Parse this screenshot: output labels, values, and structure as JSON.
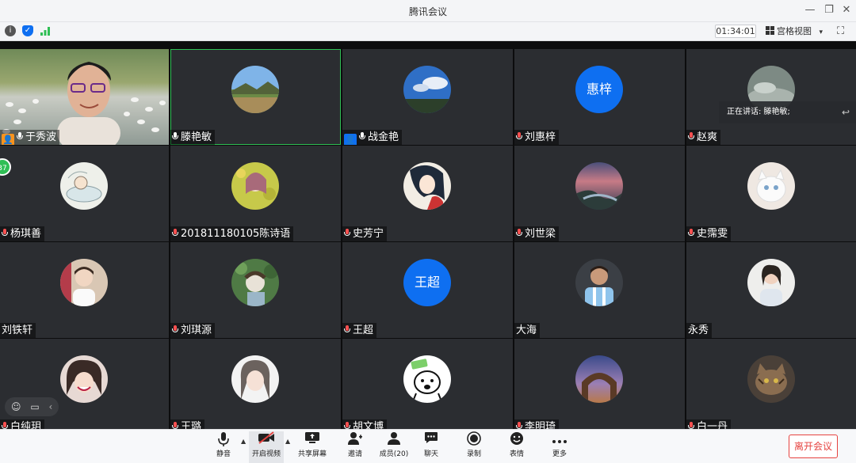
{
  "window": {
    "title": "腾讯会议",
    "controls": {
      "minimize": "—",
      "restore": "❐",
      "close": "✕"
    }
  },
  "infobar": {
    "timer": "01:34:01",
    "view_label": "宫格视图",
    "view_caret": "▾",
    "fullscreen_glyph": "⛶"
  },
  "speaking_banner": "正在讲话: 滕艳敏;",
  "participant_count_badge": "37",
  "colors": {
    "accent": "#0e6ff1",
    "active_border": "#2fbf55",
    "danger": "#e64340",
    "tile_bg": "#2b2d31"
  },
  "participants": [
    {
      "name": "于秀波",
      "mic": "on",
      "host": true,
      "video": true
    },
    {
      "name": "滕艳敏",
      "mic": "on",
      "active": true,
      "avatar": "landscape-photo"
    },
    {
      "name": "战金艳",
      "mic": "on",
      "cohost": true,
      "avatar": "blue-sky-photo"
    },
    {
      "name": "刘惠梓",
      "mic": "muted",
      "initials": "惠梓"
    },
    {
      "name": "赵爽",
      "mic": "muted",
      "avatar": "misty-photo"
    },
    {
      "name": "杨琪善",
      "mic": "muted",
      "avatar": "bath-sketch"
    },
    {
      "name": "201811180105陈诗语",
      "mic": "muted",
      "avatar": "girl-flowers"
    },
    {
      "name": "史芳宁",
      "mic": "muted",
      "avatar": "anime-girl"
    },
    {
      "name": "刘世梁",
      "mic": "muted",
      "avatar": "sunset-landscape"
    },
    {
      "name": "史霈雯",
      "mic": "muted",
      "avatar": "white-cat"
    },
    {
      "name": "刘铁轩",
      "mic": "none",
      "avatar": "person-photo"
    },
    {
      "name": "刘琪源",
      "mic": "muted",
      "avatar": "green-illustration"
    },
    {
      "name": "王超",
      "mic": "muted",
      "initials": "王超"
    },
    {
      "name": "大海",
      "mic": "none",
      "avatar": "footballer"
    },
    {
      "name": "永秀",
      "mic": "none",
      "avatar": "woman-photo"
    },
    {
      "name": "白纯玥",
      "mic": "muted",
      "avatar": "smiling-girl"
    },
    {
      "name": "王璐",
      "mic": "muted",
      "avatar": "girl-portrait"
    },
    {
      "name": "胡文博",
      "mic": "muted",
      "avatar": "cartoon-bear"
    },
    {
      "name": "李明琦",
      "mic": "muted",
      "avatar": "rock-arch-night"
    },
    {
      "name": "白一丹",
      "mic": "muted",
      "avatar": "cat-photo"
    }
  ],
  "toolbar": {
    "mute": "静音",
    "video": "开启视频",
    "share": "共享屏幕",
    "invite": "邀请",
    "members": "成员(20)",
    "chat": "聊天",
    "record": "录制",
    "emoji": "表情",
    "more": "更多",
    "leave": "离开会议"
  }
}
